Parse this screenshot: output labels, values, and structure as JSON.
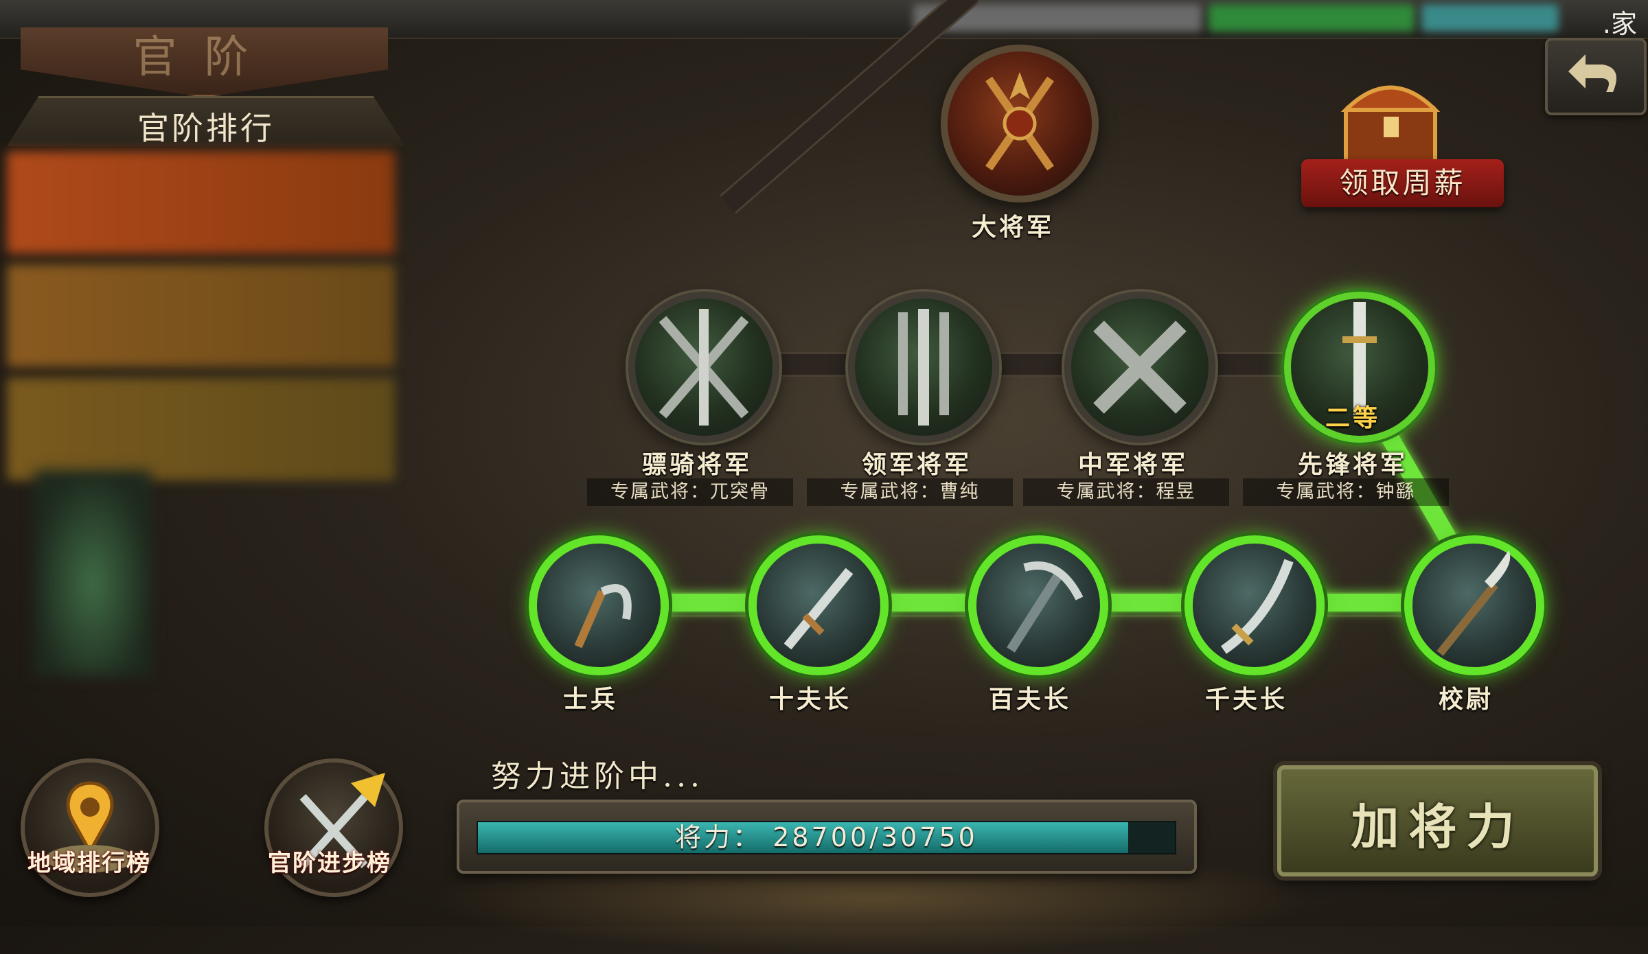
{
  "topbar": {
    "right_text": ".家"
  },
  "title_plaque": {
    "text": "官阶"
  },
  "ranking": {
    "title": "官阶排行"
  },
  "top_node": {
    "label": "大将军"
  },
  "weekly_reward": {
    "label": "领取周薪"
  },
  "generals": [
    {
      "label": "骠骑将军",
      "exclusive": "专属武将：兀突骨"
    },
    {
      "label": "领军将军",
      "exclusive": "专属武将：曹纯"
    },
    {
      "label": "中军将军",
      "exclusive": "专属武将：程昱"
    },
    {
      "label": "先锋将军",
      "exclusive": "专属武将：钟繇",
      "badge": "二等"
    }
  ],
  "ranks": [
    {
      "label": "士兵"
    },
    {
      "label": "十夫长"
    },
    {
      "label": "百夫长"
    },
    {
      "label": "千夫长"
    },
    {
      "label": "校尉"
    }
  ],
  "bottom_icons": {
    "region": "地域排行榜",
    "progress": "官阶进步榜"
  },
  "status": {
    "text": "努力进阶中..."
  },
  "progress": {
    "label": "将力： 28700/30750",
    "current": 28700,
    "max": 30750
  },
  "add_button": {
    "label": "加将力"
  },
  "colors": {
    "active_green": "#6ee53a",
    "progress_teal": "#2a9a96",
    "reward_red": "#a4201a"
  }
}
